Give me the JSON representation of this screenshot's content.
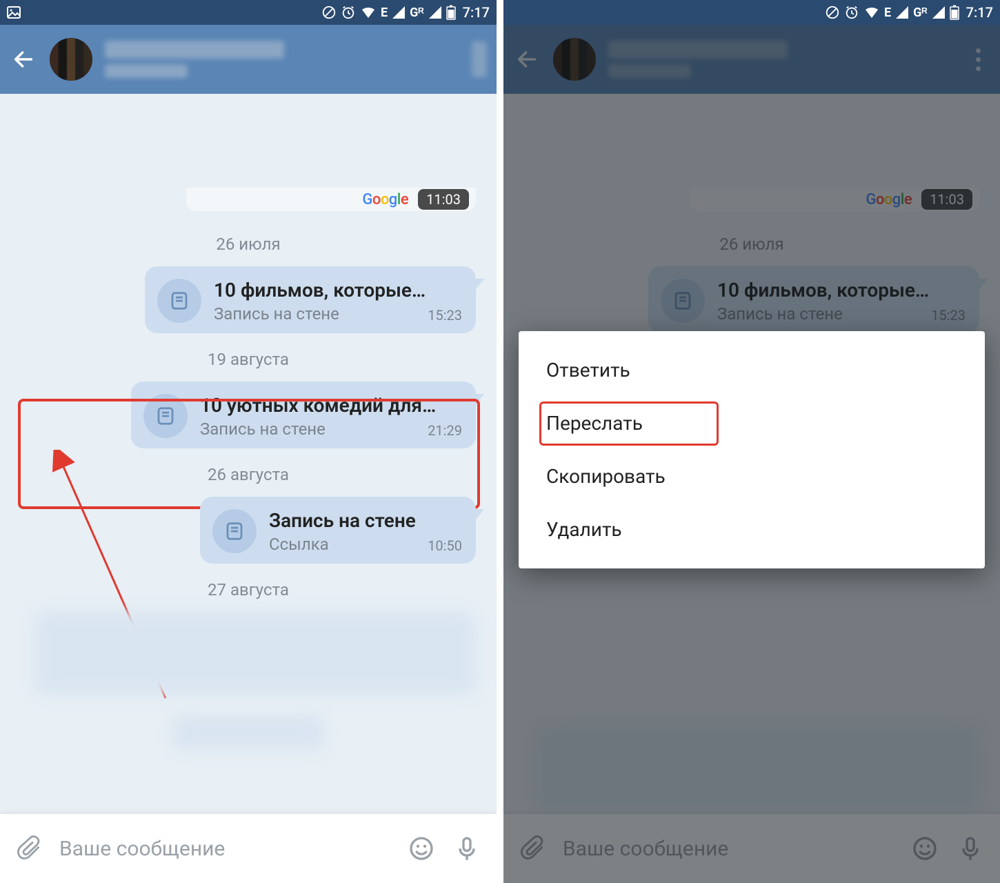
{
  "status": {
    "time": "7:17",
    "net_label": "E",
    "gr_label": "Gᴿ"
  },
  "map": {
    "logo": "Google",
    "time": "11:03"
  },
  "dates": {
    "d1": "26 июля",
    "d2": "19 августа",
    "d3": "26 августа",
    "d4": "27 августа"
  },
  "msgs": {
    "m1": {
      "title": "10 фильмов, которые…",
      "sub": "Запись на стене",
      "time": "15:23"
    },
    "m2": {
      "title": "10 уютных комедий для…",
      "sub": "Запись на стене",
      "time": "21:29"
    },
    "m3": {
      "title": "Запись на стене",
      "sub": "Ссылка",
      "time": "10:50"
    }
  },
  "input": {
    "placeholder": "Ваше сообщение"
  },
  "menu": {
    "reply": "Ответить",
    "forward": "Переслать",
    "copy": "Скопировать",
    "delete": "Удалить"
  }
}
